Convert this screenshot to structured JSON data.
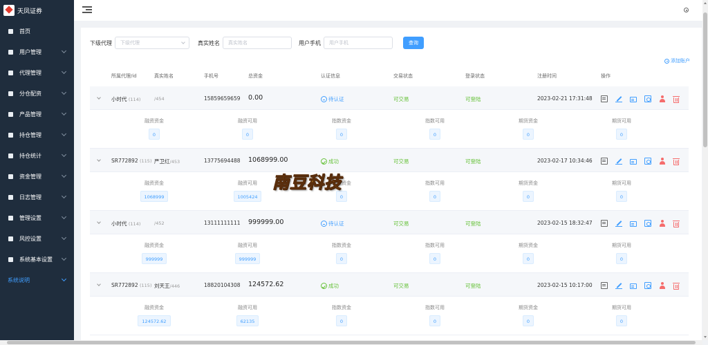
{
  "brand": {
    "title": "天凤证券"
  },
  "sidebar": {
    "items": [
      {
        "label": "首页",
        "icon": "home-icon"
      },
      {
        "label": "用户管理",
        "icon": "user-icon"
      },
      {
        "label": "代理管理",
        "icon": "org-icon"
      },
      {
        "label": "分仓配资",
        "icon": "org-icon"
      },
      {
        "label": "产品管理",
        "icon": "box-icon"
      },
      {
        "label": "持仓管理",
        "icon": "house-icon"
      },
      {
        "label": "持仓统计",
        "icon": "cube-icon"
      },
      {
        "label": "资金管理",
        "icon": "doc-icon"
      },
      {
        "label": "日志管理",
        "icon": "doc-icon"
      },
      {
        "label": "管理设置",
        "icon": "sliders-icon"
      },
      {
        "label": "风控设置",
        "icon": "shield-icon"
      },
      {
        "label": "系统基本设置",
        "icon": "gear-icon"
      },
      {
        "label": "系统说明",
        "icon": ""
      }
    ]
  },
  "filters": {
    "agent_label": "下级代理",
    "agent_placeholder": "下级代理",
    "name_label": "真实姓名",
    "name_placeholder": "真实姓名",
    "phone_label": "用户手机",
    "phone_placeholder": "用户手机",
    "query_button": "查询"
  },
  "add_account": "添加账户",
  "table": {
    "headers": {
      "agent": "所属代理/id",
      "name": "真实姓名",
      "phone": "手机号",
      "total": "总资金",
      "auth": "认证信息",
      "trade": "交易状态",
      "login": "登录状态",
      "time": "注册时间",
      "ops": "操作"
    },
    "detail_labels": [
      "融资资金",
      "融资可用",
      "指数资金",
      "指数可用",
      "期货资金",
      "期货可用"
    ],
    "rows": [
      {
        "agent": "小时代",
        "agent_id": "(114)",
        "name": "",
        "uid": "/454",
        "phone": "15859659659",
        "total": "0.00",
        "auth": "待认证",
        "auth_status": "pending",
        "trade": "可交易",
        "login": "可登陆",
        "time": "2023-02-21 17:31:48",
        "funds": [
          "0",
          "0",
          "0",
          "0",
          "0",
          "0"
        ]
      },
      {
        "agent": "SR772892",
        "agent_id": "(115)",
        "name": "严卫红",
        "uid": "/453",
        "phone": "13775694488",
        "total": "1068999.00",
        "auth": "成功",
        "auth_status": "ok",
        "trade": "可交易",
        "login": "可登陆",
        "time": "2023-02-17 10:34:46",
        "funds": [
          "1068999",
          "1005424",
          "0",
          "0",
          "0",
          "0"
        ]
      },
      {
        "agent": "小时代",
        "agent_id": "(114)",
        "name": "",
        "uid": "/452",
        "phone": "13111111111",
        "total": "999999.00",
        "auth": "待认证",
        "auth_status": "pending",
        "trade": "可交易",
        "login": "可登陆",
        "time": "2023-02-15 18:32:47",
        "funds": [
          "999999",
          "999999",
          "0",
          "0",
          "0",
          "0"
        ]
      },
      {
        "agent": "SR772892",
        "agent_id": "(115)",
        "name": "刘天王",
        "uid": "/446",
        "phone": "18820104308",
        "total": "124572.62",
        "auth": "成功",
        "auth_status": "ok",
        "trade": "可交易",
        "login": "可登陆",
        "time": "2023-02-15 10:17:00",
        "funds": [
          "124572.62",
          "62135",
          "0",
          "0",
          "0",
          "0"
        ]
      }
    ]
  },
  "watermark": "南豆科技",
  "colors": {
    "sidebar_bg": "#1f2d3d",
    "primary": "#409eff",
    "success": "#67c23a",
    "danger": "#f56c6c"
  }
}
